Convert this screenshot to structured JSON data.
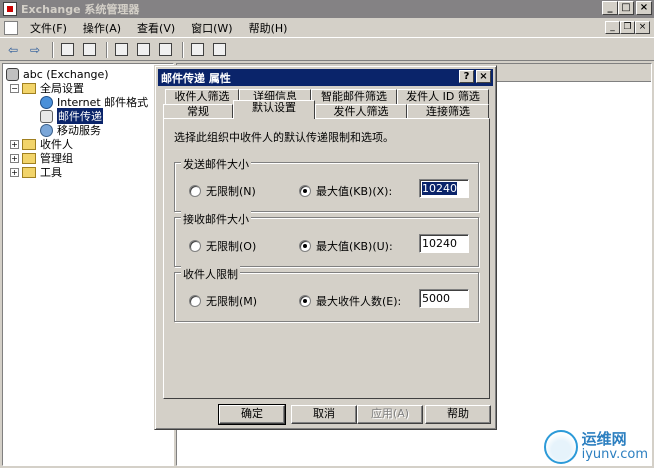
{
  "window": {
    "title": "Exchange 系统管理器"
  },
  "menu": {
    "items": [
      "文件(F)",
      "操作(A)",
      "查看(V)",
      "窗口(W)",
      "帮助(H)"
    ]
  },
  "tree": {
    "root": "abc (Exchange)",
    "global_settings": "全局设置",
    "internet_format": "Internet 邮件格式",
    "mail_delivery": "邮件传递",
    "mobile_services": "移动服务",
    "recipients": "收件人",
    "admin_groups": "管理组",
    "tools": "工具"
  },
  "dialog": {
    "title": "邮件传递 属性",
    "tabs_back": [
      "收件人筛选",
      "详细信息",
      "智能邮件筛选",
      "发件人 ID 筛选"
    ],
    "tabs_front": [
      "常规",
      "默认设置",
      "发件人筛选",
      "连接筛选"
    ],
    "description": "选择此组织中收件人的默认传递限制和选项。",
    "send_group": {
      "label": "发送邮件大小",
      "unlimited": "无限制(N)",
      "max": "最大值(KB)(X):",
      "value": "10240"
    },
    "receive_group": {
      "label": "接收邮件大小",
      "unlimited": "无限制(O)",
      "max": "最大值(KB)(U):",
      "value": "10240"
    },
    "recipient_group": {
      "label": "收件人限制",
      "unlimited": "无限制(M)",
      "max": "最大收件人数(E):",
      "value": "5000"
    },
    "buttons": {
      "ok": "确定",
      "cancel": "取消",
      "apply": "应用(A)",
      "help": "帮助"
    }
  },
  "watermark": {
    "cn": "运维网",
    "en": "iyunv.com"
  }
}
